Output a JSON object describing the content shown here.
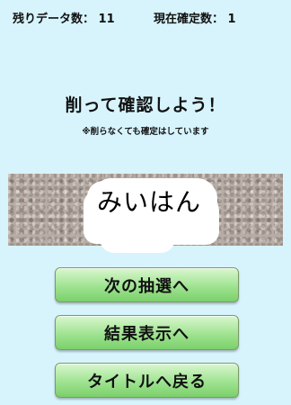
{
  "status": {
    "remaining_label": "残りデータ数：",
    "remaining_value": "11",
    "confirmed_label": "現在確定数：",
    "confirmed_value": "1"
  },
  "main": {
    "heading": "削って確認しよう！",
    "note": "※削らなくても確定はしています",
    "revealed_text": "みいはん"
  },
  "buttons": {
    "next_draw": "次の抽選へ",
    "show_results": "結果表示へ",
    "back_to_title": "タイトルへ戻る"
  },
  "colors": {
    "background": "#d7f4fd",
    "button_green": "#9fe391",
    "scratch_gray": "#b8aca4"
  }
}
